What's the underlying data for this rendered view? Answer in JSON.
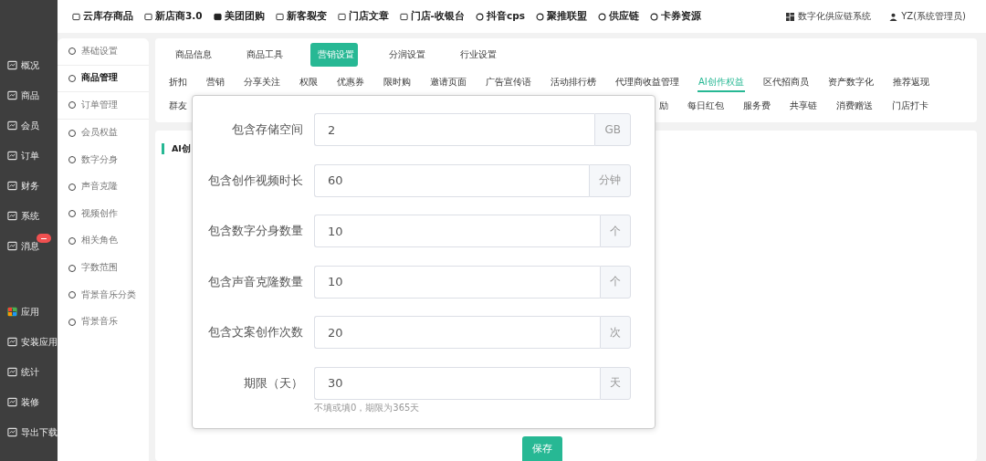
{
  "top_nav": {
    "links": [
      "云库存商品",
      "新店商3.0",
      "美团团购",
      "新客裂变",
      "门店文章",
      "门店-收银台",
      "抖音cps",
      "聚推联盟",
      "供应链",
      "卡券资源"
    ],
    "system": "数字化供应链系统",
    "user": "YZ(系统管理员)"
  },
  "main_sidebar": {
    "groups": [
      [
        {
          "label": "概况",
          "badge": false
        },
        {
          "label": "商品",
          "badge": false
        },
        {
          "label": "会员",
          "badge": false
        },
        {
          "label": "订单",
          "badge": false
        },
        {
          "label": "财务",
          "badge": false
        },
        {
          "label": "系统",
          "badge": false
        },
        {
          "label": "消息",
          "badge": true
        }
      ],
      [
        {
          "label": "应用",
          "badge": false
        },
        {
          "label": "安装应用",
          "badge": false
        },
        {
          "label": "统计",
          "badge": false
        },
        {
          "label": "装修",
          "badge": false
        },
        {
          "label": "导出下载",
          "badge": false
        }
      ]
    ]
  },
  "sub_sidebar": [
    {
      "label": "基础设置",
      "selected": false
    },
    {
      "label": "商品管理",
      "selected": true
    },
    {
      "label": "订单管理",
      "selected": false
    },
    {
      "label": "会员权益",
      "selected": false
    },
    {
      "label": "数字分身",
      "selected": false
    },
    {
      "label": "声音克隆",
      "selected": false
    },
    {
      "label": "视频创作",
      "selected": false
    },
    {
      "label": "相关角色",
      "selected": false
    },
    {
      "label": "字数范围",
      "selected": false
    },
    {
      "label": "背景音乐分类",
      "selected": false
    },
    {
      "label": "背景音乐",
      "selected": false
    }
  ],
  "tabs": [
    {
      "label": "商品信息",
      "selected": false
    },
    {
      "label": "商品工具",
      "selected": false
    },
    {
      "label": "营销设置",
      "selected": true
    },
    {
      "label": "分润设置",
      "selected": false
    },
    {
      "label": "行业设置",
      "selected": false
    }
  ],
  "subtabs": [
    [
      {
        "label": "折扣",
        "selected": false
      },
      {
        "label": "营销",
        "selected": false
      },
      {
        "label": "分享关注",
        "selected": false
      },
      {
        "label": "权限",
        "selected": false
      },
      {
        "label": "优惠券",
        "selected": false
      },
      {
        "label": "限时购",
        "selected": false
      },
      {
        "label": "邀请页面",
        "selected": false
      },
      {
        "label": "广告宣传语",
        "selected": false
      },
      {
        "label": "活动排行榜",
        "selected": false
      },
      {
        "label": "代理商收益管理",
        "selected": false
      },
      {
        "label": "AI创作权益",
        "selected": true
      },
      {
        "label": "区代招商员",
        "selected": false
      },
      {
        "label": "资产数字化",
        "selected": false
      },
      {
        "label": "推荐返现",
        "selected": false
      }
    ],
    [
      {
        "label": "群友",
        "selected": false
      },
      {
        "label": "励",
        "selected": false
      },
      {
        "label": "每日红包",
        "selected": false
      },
      {
        "label": "服务费",
        "selected": false
      },
      {
        "label": "共享链",
        "selected": false
      },
      {
        "label": "消费赠送",
        "selected": false
      },
      {
        "label": "门店打卡",
        "selected": false
      }
    ]
  ],
  "section_title": "AI创",
  "dialog": {
    "fields": [
      {
        "label": "包含存储空间",
        "value": "2",
        "unit": "GB"
      },
      {
        "label": "包含创作视频时长",
        "value": "60",
        "unit": "分钟"
      },
      {
        "label": "包含数字分身数量",
        "value": "10",
        "unit": "个"
      },
      {
        "label": "包含声音克隆数量",
        "value": "10",
        "unit": "个"
      },
      {
        "label": "包含文案创作次数",
        "value": "20",
        "unit": "次"
      },
      {
        "label": "期限（天）",
        "value": "30",
        "unit": "天"
      }
    ],
    "hint": "不填或填0，期限为365天"
  },
  "save_button": "保存"
}
